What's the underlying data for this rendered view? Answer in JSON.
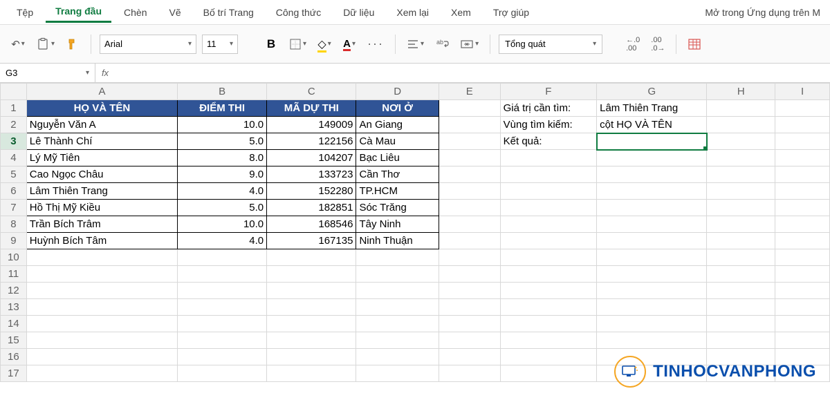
{
  "tabs": [
    "Tệp",
    "Trang đầu",
    "Chèn",
    "Vẽ",
    "Bố trí Trang",
    "Công thức",
    "Dữ liệu",
    "Xem lại",
    "Xem",
    "Trợ giúp"
  ],
  "active_tab": 1,
  "right_text": "Mở trong Ứng dụng trên M",
  "ribbon": {
    "font_name": "Arial",
    "font_size": "11",
    "number_format": "Tổng quát"
  },
  "namebox": "G3",
  "columns": [
    "A",
    "B",
    "C",
    "D",
    "E",
    "F",
    "G",
    "H",
    "I"
  ],
  "header_row": {
    "A": "HỌ VÀ TÊN",
    "B": "ĐIỂM THI",
    "C": "MÃ DỰ THI",
    "D": "NƠI Ở"
  },
  "data_rows": [
    {
      "A": "Nguyễn Văn A",
      "B": "10.0",
      "C": "149009",
      "D": "An Giang"
    },
    {
      "A": "Lê Thành Chí",
      "B": "5.0",
      "C": "122156",
      "D": "Cà Mau"
    },
    {
      "A": "Lý Mỹ Tiên",
      "B": "8.0",
      "C": "104207",
      "D": "Bạc Liêu"
    },
    {
      "A": "Cao Ngọc Châu",
      "B": "9.0",
      "C": "133723",
      "D": "Cần Thơ"
    },
    {
      "A": "Lâm Thiên Trang",
      "B": "4.0",
      "C": "152280",
      "D": "TP.HCM"
    },
    {
      "A": "Hồ Thị Mỹ Kiều",
      "B": "5.0",
      "C": "182851",
      "D": "Sóc Trăng"
    },
    {
      "A": "Trần Bích Trâm",
      "B": "10.0",
      "C": "168546",
      "D": "Tây Ninh"
    },
    {
      "A": "Huỳnh Bích Tâm",
      "B": "4.0",
      "C": "167135",
      "D": "Ninh Thuận"
    }
  ],
  "side_labels": {
    "F1": "Giá trị cần tìm:",
    "G1": "Lâm Thiên Trang",
    "F2": "Vùng tìm kiếm:",
    "G2": "cột HỌ VÀ TÊN",
    "F3": "Kết quả:"
  },
  "total_rows": 17,
  "selected": {
    "row": 3,
    "col": "G"
  },
  "logo_text": "TINHOCVANPHONG",
  "decimal_decrease": ".0",
  "decimal_increase": ".00"
}
